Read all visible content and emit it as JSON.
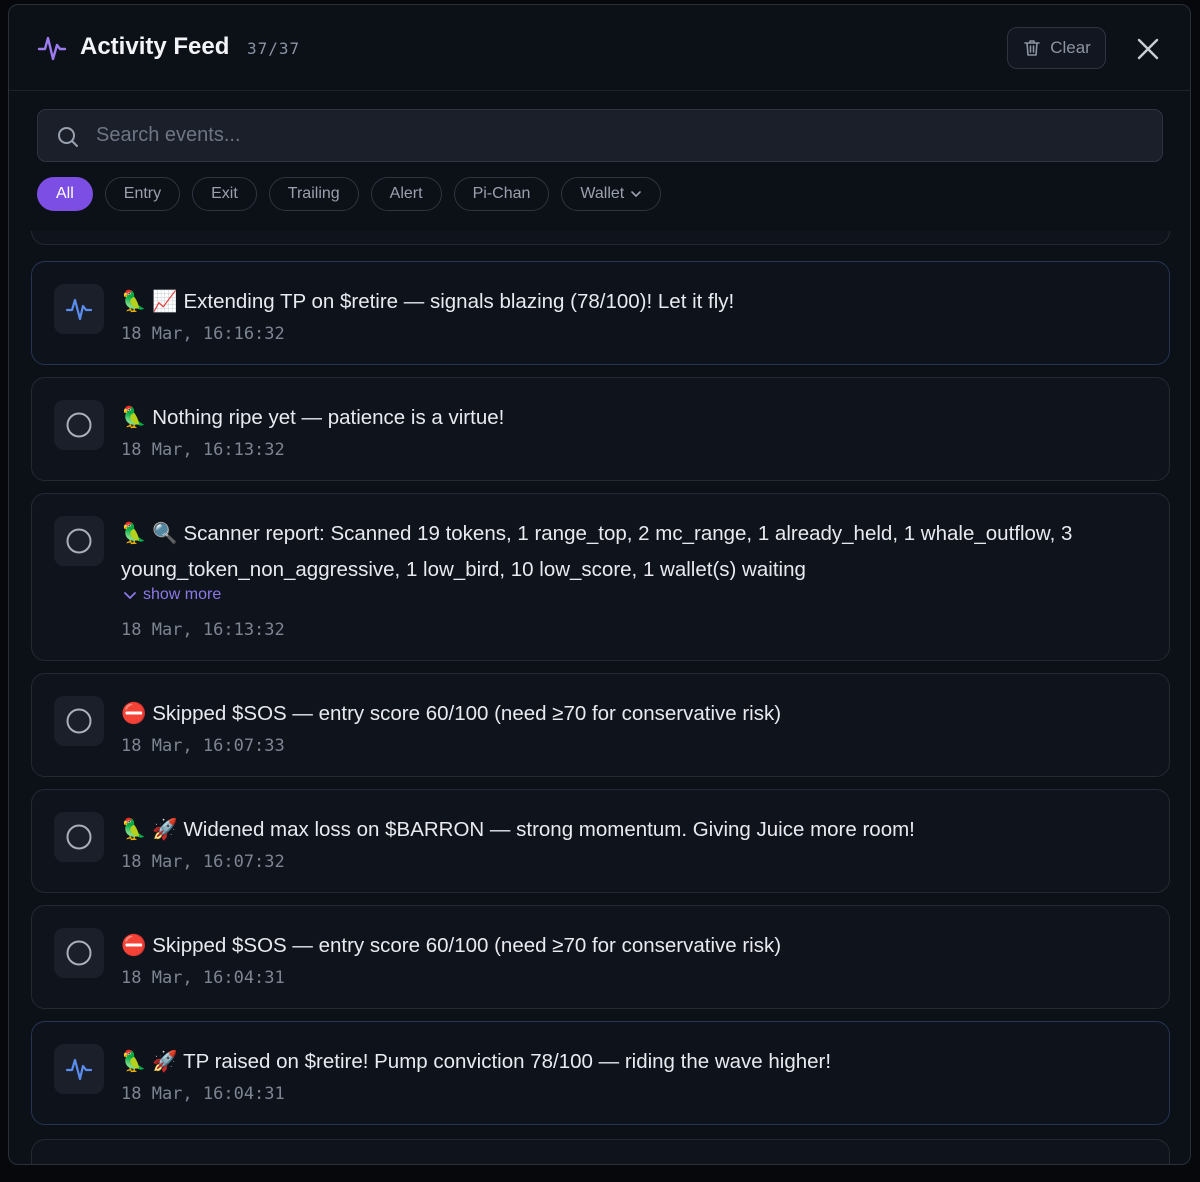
{
  "header": {
    "title": "Activity Feed",
    "count": "37/37",
    "clear_label": "Clear"
  },
  "search": {
    "placeholder": "Search events..."
  },
  "filters": [
    {
      "label": "All",
      "active": true
    },
    {
      "label": "Entry"
    },
    {
      "label": "Exit"
    },
    {
      "label": "Trailing"
    },
    {
      "label": "Alert"
    },
    {
      "label": "Pi-Chan"
    },
    {
      "label": "Wallet",
      "dropdown": true
    }
  ],
  "events": [
    {
      "icon": "activity-icon",
      "prefix": "🦜 📈",
      "text": "Extending TP on $retire — signals blazing (78/100)! Let it fly!",
      "time": "18 Mar, 16:16:32"
    },
    {
      "icon": "circle-icon",
      "prefix": "🦜",
      "text": "Nothing ripe yet — patience is a virtue!",
      "time": "18 Mar, 16:13:32"
    },
    {
      "icon": "circle-icon",
      "prefix": "🦜 🔍",
      "text": "Scanner report: Scanned 19 tokens, 1 range_top, 2 mc_range, 1 already_held, 1 whale_outflow, 3 young_token_non_aggressive, 1 low_bird, 10 low_score, 1 wallet(s) waiting",
      "show_more": "show more",
      "time": "18 Mar, 16:13:32"
    },
    {
      "icon": "circle-icon",
      "prefix": "⛔",
      "text": "Skipped $SOS — entry score 60/100 (need ≥70 for conservative risk)",
      "time": "18 Mar, 16:07:33"
    },
    {
      "icon": "circle-icon",
      "prefix": "🦜 🚀",
      "text": "Widened max loss on $BARRON — strong momentum. Giving Juice more room!",
      "time": "18 Mar, 16:07:32"
    },
    {
      "icon": "circle-icon",
      "prefix": "⛔",
      "text": "Skipped $SOS — entry score 60/100 (need ≥70 for conservative risk)",
      "time": "18 Mar, 16:04:31"
    },
    {
      "icon": "activity-icon",
      "prefix": "🦜 🚀",
      "text": "TP raised on $retire! Pump conviction 78/100 — riding the wave higher!",
      "time": "18 Mar, 16:04:31"
    }
  ],
  "colors": {
    "accent": "#7c4ee4",
    "activity_icon": "#5b8def",
    "background": "#0c1017"
  }
}
